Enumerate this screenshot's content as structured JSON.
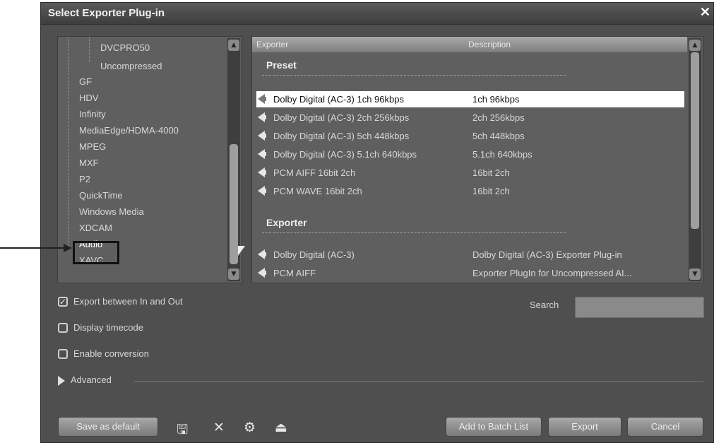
{
  "window": {
    "title": "Select Exporter Plug-in",
    "close_glyph": "✕"
  },
  "tree": {
    "items": [
      "DVCPRO50",
      "Uncompressed",
      "GF",
      "HDV",
      "Infinity",
      "MediaEdge/HDMA-4000",
      "MPEG",
      "MXF",
      "P2",
      "QuickTime",
      "Windows Media",
      "XDCAM",
      "Audio",
      "XAVC"
    ],
    "selected": "Audio"
  },
  "list": {
    "headers": {
      "name": "Exporter",
      "description": "Description"
    },
    "groups": [
      {
        "label": "Preset",
        "rows": [
          {
            "name": "Dolby Digital (AC-3) 1ch 96kbps",
            "description": "1ch 96kbps",
            "selected": true
          },
          {
            "name": "Dolby Digital (AC-3) 2ch 256kbps",
            "description": "2ch 256kbps"
          },
          {
            "name": "Dolby Digital (AC-3) 5ch 448kbps",
            "description": "5ch 448kbps"
          },
          {
            "name": "Dolby Digital (AC-3) 5.1ch 640kbps",
            "description": "5.1ch 640kbps"
          },
          {
            "name": "PCM AIFF 16bit 2ch",
            "description": "16bit 2ch"
          },
          {
            "name": "PCM WAVE 16bit 2ch",
            "description": "16bit 2ch"
          }
        ]
      },
      {
        "label": "Exporter",
        "rows": [
          {
            "name": "Dolby Digital (AC-3)",
            "description": "Dolby Digital (AC-3) Exporter Plug-in"
          },
          {
            "name": "PCM AIFF",
            "description": "Exporter PlugIn for Uncompressed AI..."
          }
        ]
      }
    ],
    "row_icon": "speaker-icon"
  },
  "options": {
    "export_in_out": {
      "label": "Export between In and Out",
      "checked": true
    },
    "display_timecode": {
      "label": "Display timecode",
      "checked": false
    },
    "enable_conversion": {
      "label": "Enable conversion",
      "checked": false
    },
    "advanced": {
      "label": "Advanced",
      "icon": "triangle-right-icon"
    },
    "search": {
      "label": "Search",
      "value": ""
    }
  },
  "toolbar": {
    "save_default": "Save as default",
    "icons": [
      "save-icon",
      "delete-icon",
      "settings-icon",
      "export-preset-icon"
    ],
    "glyphs": {
      "save": "🖫",
      "delete": "✕",
      "settings": "⚙",
      "export": "⏏"
    }
  },
  "buttons": {
    "add_batch": "Add to Batch List",
    "export": "Export",
    "cancel": "Cancel"
  },
  "colors": {
    "dialog_bg": "#4f4f4f",
    "panel_bg": "#5f5f5f",
    "selection": "#ffffff"
  }
}
